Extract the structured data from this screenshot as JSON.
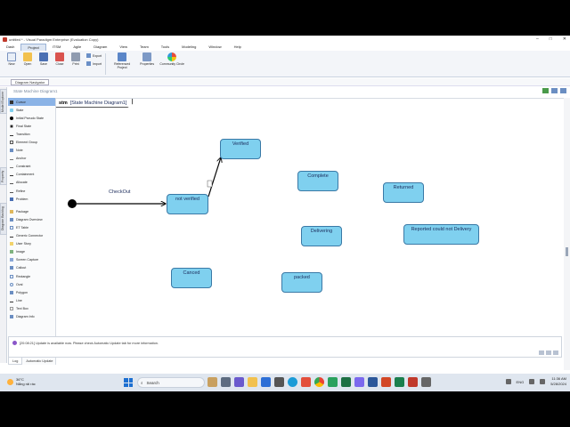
{
  "window": {
    "title": "untitled * - Visual Paradigm Enterprise (Evaluation Copy)",
    "controls": [
      "–",
      "□",
      "✕"
    ]
  },
  "menu": [
    "Dash",
    "Project",
    "ITSM",
    "Agile",
    "Diagram",
    "View",
    "Team",
    "Tools",
    "Modeling",
    "Window",
    "Help"
  ],
  "menu_active": "Project",
  "ribbon": {
    "buttons": [
      "New",
      "Open",
      "Save",
      "Close",
      "Print"
    ],
    "export_label": "Export",
    "import_label": "Import",
    "referenced_project": "Referenced Project",
    "properties": "Properties",
    "community_circle": "Community Circle"
  },
  "navigator_tab": "Diagram Navigator",
  "breadcrumb": "State Machine Diagram1",
  "side_tabs": [
    "Model Explorer",
    "Property",
    "Diagram Backlog"
  ],
  "palette": {
    "group1": [
      "Cursor",
      "State",
      "Initial Pseudo State",
      "Final State",
      "Transition",
      "Element Group",
      "Note",
      "Anchor",
      "Constraint",
      "Containment",
      "Allocate",
      "Refine",
      "Problem"
    ],
    "group2": [
      "Package",
      "Diagram Overview",
      "ET Table",
      "Generic Connector",
      "User Story",
      "Image",
      "Screen Capture",
      "Callout",
      "Rectangle",
      "Oval",
      "Polygon",
      "Line",
      "Text Box",
      "Diagram Info"
    ]
  },
  "diagram": {
    "frame_keyword": "stm",
    "frame_name": "[State Machine Diagram1]",
    "transition_label": "CheckOut",
    "states": {
      "verified": "Verified",
      "not_verified": "not verified",
      "complete": "Complete",
      "returned": "Returned",
      "delivering": "Delivering",
      "reported": "Reported could not Delivery",
      "canceled": "Canced",
      "packed": "packed"
    }
  },
  "messages": {
    "text": "[20:08:21] Update is available now. Please check Automatic Update tab for more information.",
    "tabs": [
      "Log",
      "Automatic Update"
    ]
  },
  "taskbar": {
    "weather_temp": "36°C",
    "weather_desc": "Nắng rải rác",
    "search_placeholder": "Search",
    "lang": "ENG",
    "time": "11:36 AM",
    "date": "5/28/2024"
  }
}
